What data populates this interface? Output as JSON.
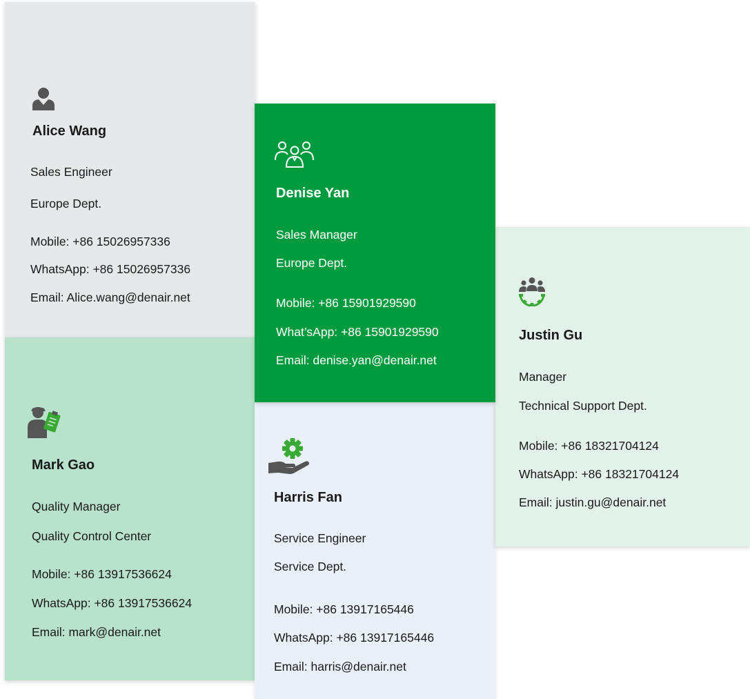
{
  "cards": {
    "alice": {
      "icon": "person-icon",
      "name": "Alice Wang",
      "title": "Sales Engineer",
      "dept": "Europe Dept.",
      "mobile": "Mobile: +86 15026957336",
      "whatsapp": "WhatsApp: +86 15026957336",
      "email": "Email: Alice.wang@denair.net",
      "bg_color": "#e6e8ea"
    },
    "denise": {
      "icon": "team-icon",
      "name": "Denise Yan",
      "title": "Sales Manager",
      "dept": "Europe Dept.",
      "mobile": "Mobile: +86 15901929590",
      "whatsapp": "What’sApp: +86 15901929590",
      "email": "Email: denise.yan@denair.net",
      "bg_color": "#009a3f"
    },
    "justin": {
      "icon": "team-gear-icon",
      "name": "Justin Gu",
      "title": "Manager",
      "dept": "Technical Support Dept.",
      "mobile": "Mobile: +86 18321704124",
      "whatsapp": "WhatsApp: +86 18321704124",
      "email": "Email: justin.gu@denair.net",
      "bg_color": "#e3f2e9"
    },
    "mark": {
      "icon": "inspector-clipboard-icon",
      "name": "Mark Gao",
      "title": "Quality Manager",
      "dept": "Quality Control Center",
      "mobile": "Mobile: +86 13917536624",
      "whatsapp": "WhatsApp: +86 13917536624",
      "email": "Email: mark@denair.net",
      "bg_color": "#b8e2cb"
    },
    "harris": {
      "icon": "hand-gear-icon",
      "name": "Harris Fan",
      "title": "Service Engineer",
      "dept": "Service Dept.",
      "mobile": "Mobile: +86 13917165446",
      "whatsapp": "WhatsApp: +86 13917165446",
      "email": "Email: harris@denair.net",
      "bg_color": "#eaf0f7"
    }
  },
  "colors": {
    "icon_gray": "#555555",
    "accent_green": "#39a935",
    "white": "#ffffff"
  }
}
